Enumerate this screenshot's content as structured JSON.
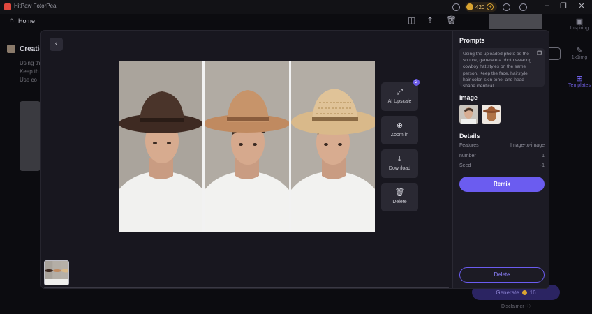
{
  "app": {
    "title": "HitPaw FotorPea",
    "credits": "420",
    "home_label": "Home"
  },
  "background": {
    "left_title": "Creatio",
    "left_lines": [
      "Using th",
      "Keep th",
      "Use co"
    ],
    "right_items": [
      {
        "label": "Inspiring",
        "icon": "image-icon"
      },
      {
        "label": "1x1img",
        "icon": "edit-icon"
      },
      {
        "label": "Templates",
        "icon": "grid-icon"
      }
    ],
    "generate_label": "Generate",
    "generate_cost": "16",
    "disclaimer": "Disclaimer"
  },
  "actions": [
    {
      "label": "AI Upscale",
      "icon": "expand-icon",
      "badge": "2"
    },
    {
      "label": "Zoom in",
      "icon": "zoom-in-icon"
    },
    {
      "label": "Download",
      "icon": "download-icon"
    },
    {
      "label": "Delete",
      "icon": "trash-icon"
    }
  ],
  "side": {
    "prompts_title": "Prompts",
    "prompt_text": "Using the uploaded photo as the source, generate a photo wearing cowboy hat styles on the same person. Keep the face, hairstyle, hair color, skin tone, and head shape identical",
    "image_title": "Image",
    "details_title": "Details",
    "details": [
      {
        "label": "Features",
        "value": "Image-to-image"
      },
      {
        "label": "number",
        "value": "1"
      },
      {
        "label": "Seed",
        "value": "-1"
      }
    ],
    "remix_label": "Remix",
    "delete_label": "Delete"
  },
  "colors": {
    "accent": "#6b5cf0",
    "modal_bg": "#18171f",
    "hat_colors": [
      "#3e2a22",
      "#c08a60",
      "#d9b98a"
    ]
  }
}
